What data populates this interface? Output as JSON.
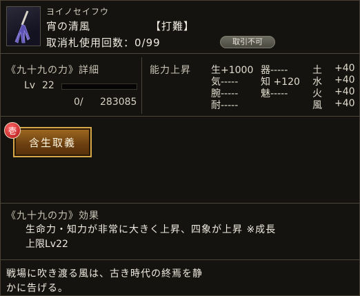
{
  "header": {
    "reading": "ヨイノセイフウ",
    "name": "宵の清風",
    "category": "【打難】",
    "uses": "取消札使用回数：0/99",
    "badge": "取引不可"
  },
  "level": {
    "title": "《九十九の力》詳細",
    "lv_label": "Lv",
    "lv_value": "22",
    "xp_current": "0/",
    "xp_max": "283085",
    "xp_progress": 0
  },
  "stats": {
    "title": "能力上昇",
    "rows": [
      {
        "a": "生+1000",
        "b": "器-----",
        "elem": "土",
        "elem_val": "+40"
      },
      {
        "a": "気-----",
        "b": "知 +120",
        "elem": "水",
        "elem_val": "+40"
      },
      {
        "a": "腕-----",
        "b": "魅-----",
        "elem": "火",
        "elem_val": "+40"
      },
      {
        "a": "耐-----",
        "b": "",
        "elem": "風",
        "elem_val": "+40"
      }
    ]
  },
  "skill": {
    "badge": "壱",
    "label": "含生取義"
  },
  "effect": {
    "title": "《九十九の力》効果",
    "line1": "生命力・知力が非常に大きく上昇、四象が上昇 ※成長",
    "line2": "上限Lv22"
  },
  "flavor": {
    "line1": "戦場に吹き渡る風は、古き時代の終焉を静",
    "line2": "かに告げる。"
  }
}
